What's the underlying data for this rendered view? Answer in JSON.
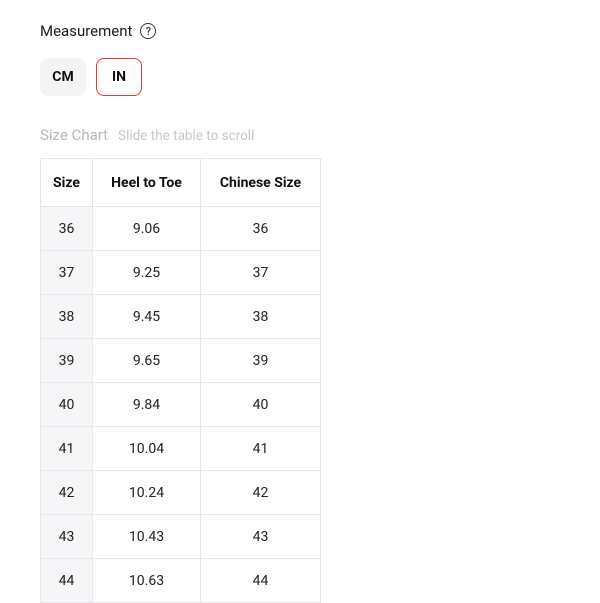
{
  "measurement": {
    "label": "Measurement",
    "help_icon_glyph": "?"
  },
  "units": {
    "cm_label": "CM",
    "in_label": "IN"
  },
  "chart": {
    "title": "Size Chart",
    "hint": "Slide the table to scroll",
    "headers": {
      "size": "Size",
      "heel_to_toe": "Heel to Toe",
      "chinese_size": "Chinese Size"
    },
    "rows": [
      {
        "size": "36",
        "heel_to_toe": "9.06",
        "chinese_size": "36"
      },
      {
        "size": "37",
        "heel_to_toe": "9.25",
        "chinese_size": "37"
      },
      {
        "size": "38",
        "heel_to_toe": "9.45",
        "chinese_size": "38"
      },
      {
        "size": "39",
        "heel_to_toe": "9.65",
        "chinese_size": "39"
      },
      {
        "size": "40",
        "heel_to_toe": "9.84",
        "chinese_size": "40"
      },
      {
        "size": "41",
        "heel_to_toe": "10.04",
        "chinese_size": "41"
      },
      {
        "size": "42",
        "heel_to_toe": "10.24",
        "chinese_size": "42"
      },
      {
        "size": "43",
        "heel_to_toe": "10.43",
        "chinese_size": "43"
      },
      {
        "size": "44",
        "heel_to_toe": "10.63",
        "chinese_size": "44"
      }
    ]
  }
}
